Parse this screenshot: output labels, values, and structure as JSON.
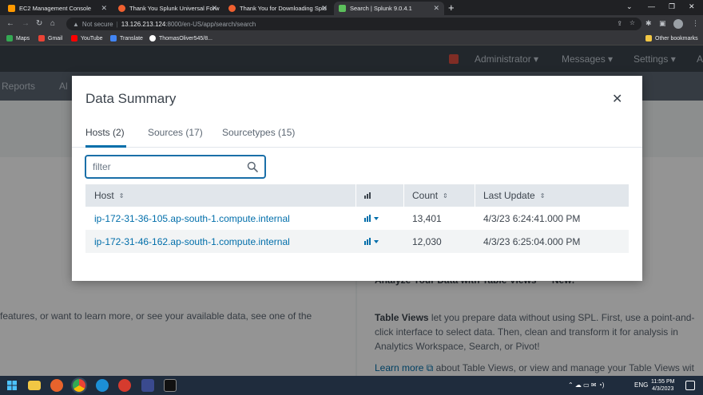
{
  "browser": {
    "tabs": [
      {
        "title": "EC2 Management Console",
        "color": "#ff9900"
      },
      {
        "title": "Thank You Splunk Universal Forw",
        "color": "#f06030"
      },
      {
        "title": "Thank You for Downloading Splu",
        "color": "#f06030"
      },
      {
        "title": "Search | Splunk 9.0.4.1",
        "color": "#5cc05c"
      }
    ],
    "url_prefix": "Not secure",
    "url_host": "13.126.213.124",
    "url_rest": ":8000/en-US/app/search/search",
    "bookmarks": [
      {
        "label": "Maps",
        "color": "#34a853"
      },
      {
        "label": "Gmail",
        "color": "#ea4335"
      },
      {
        "label": "YouTube",
        "color": "#ff0000"
      },
      {
        "label": "Translate",
        "color": "#4285f4"
      },
      {
        "label": "ThomasOliver545/8...",
        "color": "#ffffff"
      }
    ],
    "other_bookmarks": "Other bookmarks"
  },
  "appbar": {
    "administrator": "Administrator ▾",
    "messages": "Messages ▾",
    "settings": "Settings ▾",
    "more": "A"
  },
  "subbar": {
    "reports": "Reports",
    "alerts": "Al"
  },
  "background": {
    "left_text": "features, or want to learn more, or see your available data, see one of the",
    "right_heading": "Analyze Your Data with Table Views",
    "right_heading_badge": "New!",
    "right_text_bold": "Table Views",
    "right_text_1": " let you prepare data without using SPL. First, use a point-and-",
    "right_text_2": "click interface to select data. Then, clean and transform it for analysis in",
    "right_text_3": "Analytics Workspace, Search, or Pivot!",
    "right_link": "Learn more",
    "right_text_4": " about Table Views, or view and manage your Table Views wit"
  },
  "modal": {
    "title": "Data Summary",
    "close": "✕",
    "tabs": [
      {
        "label": "Hosts (2)",
        "active": true
      },
      {
        "label": "Sources (17)",
        "active": false
      },
      {
        "label": "Sourcetypes (15)",
        "active": false
      }
    ],
    "filter": {
      "placeholder": "filter",
      "value": ""
    },
    "table": {
      "columns": [
        "Host",
        "Count",
        "Last Update"
      ],
      "sort_glyph": "⇕",
      "rows": [
        {
          "host": "ip-172-31-36-105.ap-south-1.compute.internal",
          "count": "13,401",
          "last_update": "4/3/23 6:24:41.000 PM"
        },
        {
          "host": "ip-172-31-46-162.ap-south-1.compute.internal",
          "count": "12,030",
          "last_update": "4/3/23 6:25:04.000 PM"
        }
      ]
    }
  },
  "taskbar": {
    "lang": "ENG",
    "time": "11:55 PM",
    "date": "4/3/2023"
  }
}
